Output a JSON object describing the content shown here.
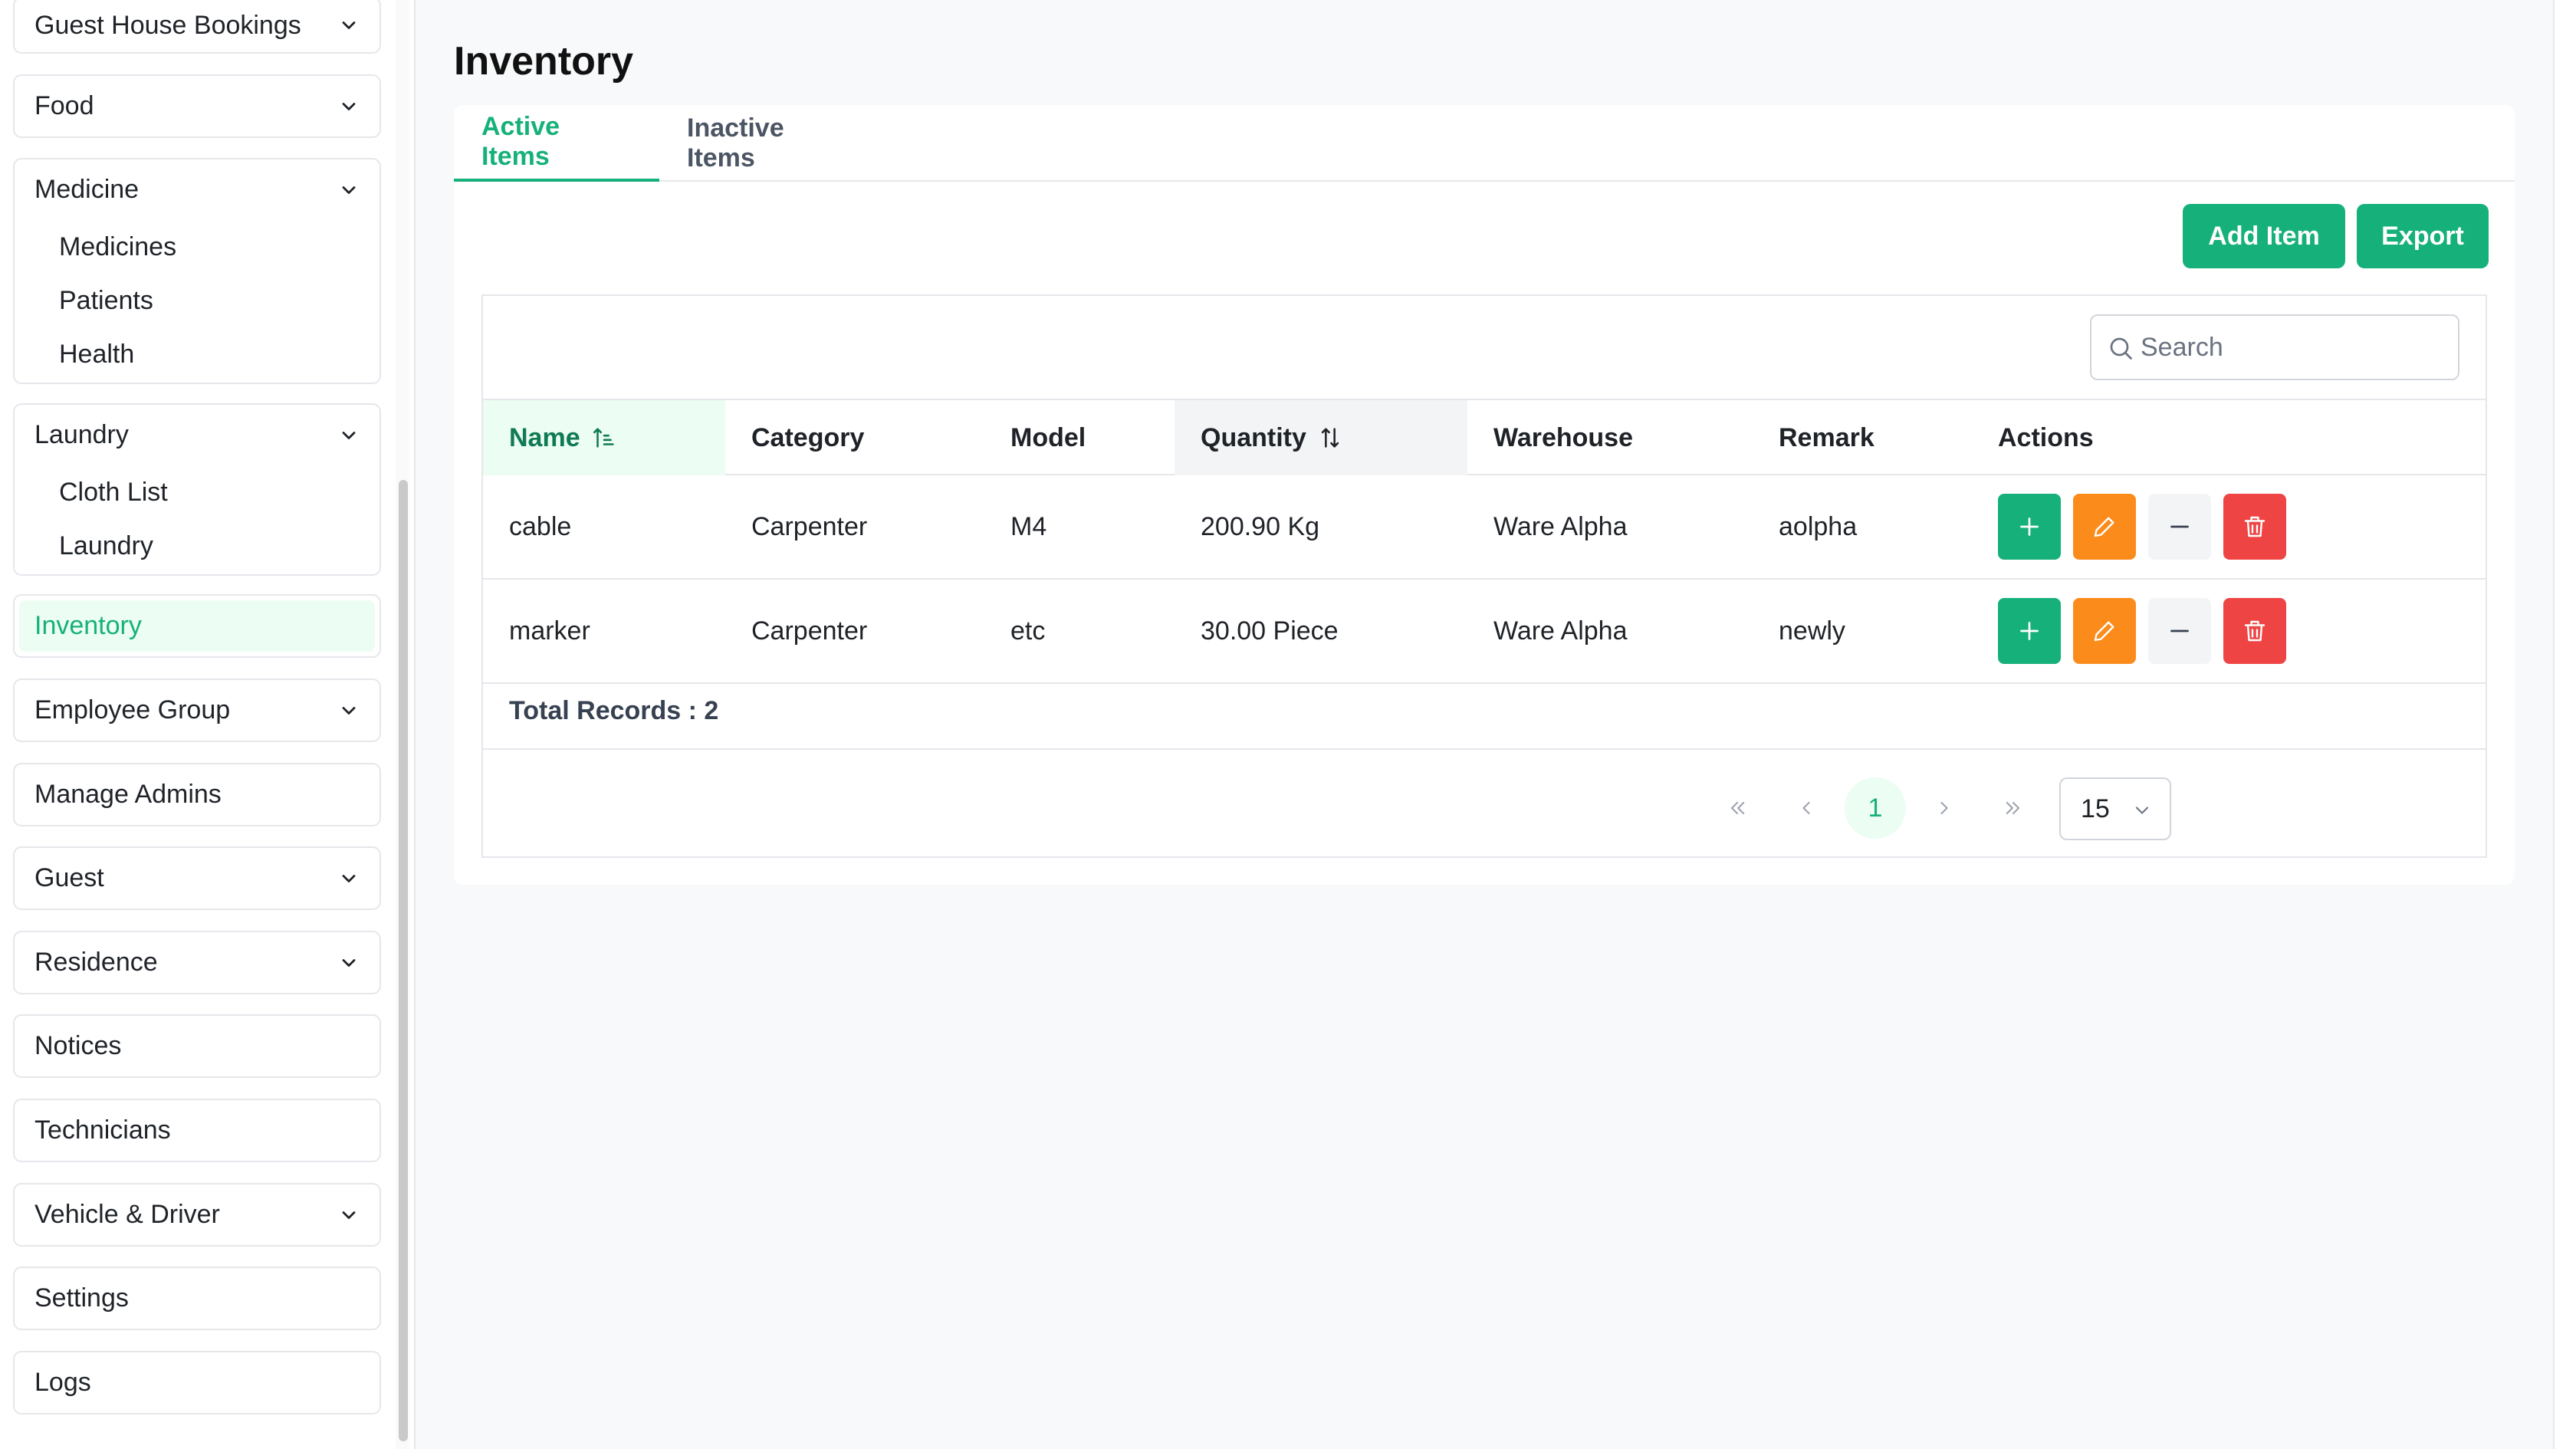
{
  "sidebar": {
    "groups": [
      {
        "label": "Guest House Bookings",
        "expandable": true,
        "items": []
      },
      {
        "label": "Food",
        "expandable": true,
        "items": []
      },
      {
        "label": "Medicine",
        "expandable": true,
        "items": [
          "Medicines",
          "Patients",
          "Health"
        ]
      },
      {
        "label": "Laundry",
        "expandable": true,
        "items": [
          "Cloth List",
          "Laundry"
        ]
      },
      {
        "label": "Inventory",
        "expandable": false,
        "active": true,
        "items": []
      },
      {
        "label": "Employee Group",
        "expandable": true,
        "items": []
      },
      {
        "label": "Manage Admins",
        "expandable": false,
        "items": []
      },
      {
        "label": "Guest",
        "expandable": true,
        "items": []
      },
      {
        "label": "Residence",
        "expandable": true,
        "items": []
      },
      {
        "label": "Notices",
        "expandable": false,
        "items": []
      },
      {
        "label": "Technicians",
        "expandable": false,
        "items": []
      },
      {
        "label": "Vehicle & Driver",
        "expandable": true,
        "items": []
      },
      {
        "label": "Settings",
        "expandable": false,
        "items": []
      },
      {
        "label": "Logs",
        "expandable": false,
        "items": []
      }
    ]
  },
  "page": {
    "title": "Inventory"
  },
  "tabs": [
    {
      "label": "Active Items",
      "active": true
    },
    {
      "label": "Inactive Items",
      "active": false
    }
  ],
  "toolbar": {
    "add_label": "Add Item",
    "export_label": "Export"
  },
  "search": {
    "placeholder": "Search",
    "value": ""
  },
  "table": {
    "columns": [
      "Name",
      "Category",
      "Model",
      "Quantity",
      "Warehouse",
      "Remark",
      "Actions"
    ],
    "rows": [
      {
        "name": "cable",
        "category": "Carpenter",
        "model": "M4",
        "quantity": "200.90 Kg",
        "warehouse": "Ware Alpha",
        "remark": "aolpha"
      },
      {
        "name": "marker",
        "category": "Carpenter",
        "model": "etc",
        "quantity": "30.00 Piece",
        "warehouse": "Ware Alpha",
        "remark": "newly"
      }
    ],
    "total_label": "Total Records : 2"
  },
  "pagination": {
    "current_page": "1",
    "per_page": "15"
  },
  "colors": {
    "accent": "#16b17a",
    "edit": "#fb8c1c",
    "danger": "#ef4444",
    "muted": "#f3f4f6"
  },
  "icons": {
    "chevron": "chevron-down-icon",
    "search": "search-icon",
    "sort_asc": "sort-ascending-icon",
    "sort": "sort-icon",
    "add": "plus-icon",
    "edit": "pencil-icon",
    "minus": "minus-icon",
    "delete": "trash-icon"
  }
}
